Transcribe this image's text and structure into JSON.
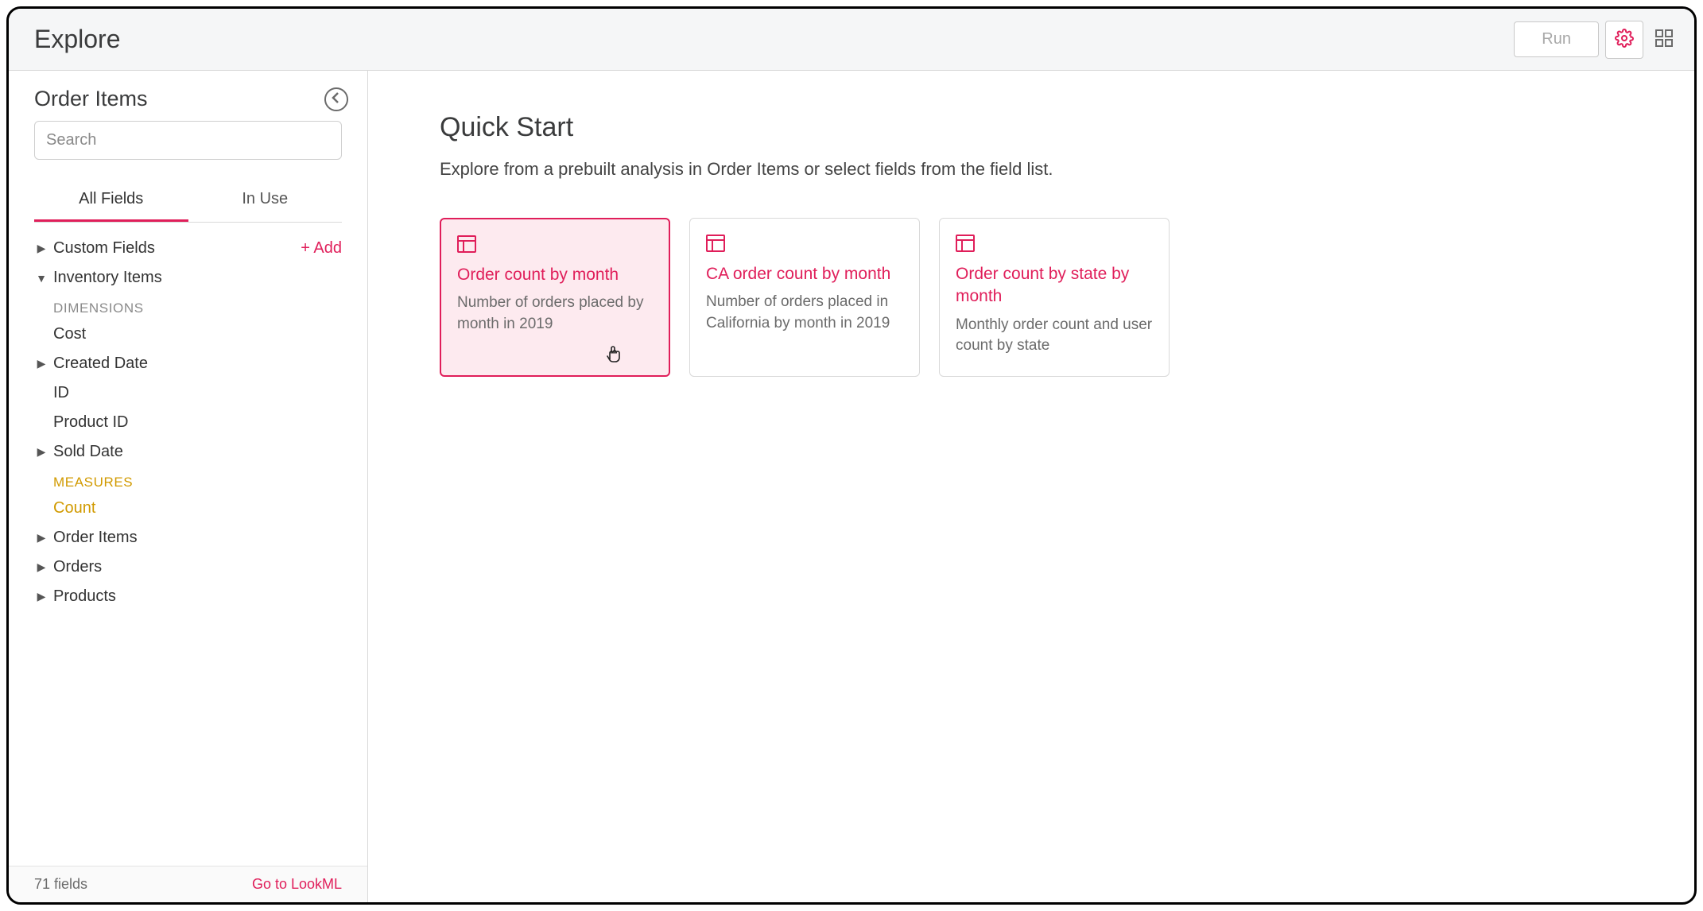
{
  "toolbar": {
    "title": "Explore",
    "run_label": "Run"
  },
  "sidebar": {
    "title": "Order Items",
    "search_placeholder": "Search",
    "tabs": {
      "all_fields": "All Fields",
      "in_use": "In Use"
    },
    "custom_fields": "Custom Fields",
    "add_label": "+  Add",
    "inventory_items": "Inventory Items",
    "dimensions_label": "DIMENSIONS",
    "dim_cost": "Cost",
    "dim_created_date": "Created Date",
    "dim_id": "ID",
    "dim_product_id": "Product ID",
    "dim_sold_date": "Sold Date",
    "measures_label": "MEASURES",
    "measure_count": "Count",
    "group_order_items": "Order Items",
    "group_orders": "Orders",
    "group_products": "Products",
    "footer_count": "71 fields",
    "footer_link": "Go to LookML"
  },
  "main": {
    "title": "Quick Start",
    "subtitle": "Explore from a prebuilt analysis in Order Items or select fields from the field list.",
    "cards": [
      {
        "title": "Order count by month",
        "desc": "Number of orders placed by month in 2019"
      },
      {
        "title": "CA order count by month",
        "desc": "Number of orders placed in California by month in 2019"
      },
      {
        "title": "Order count by state by month",
        "desc": "Monthly order count and user count by state"
      }
    ]
  }
}
